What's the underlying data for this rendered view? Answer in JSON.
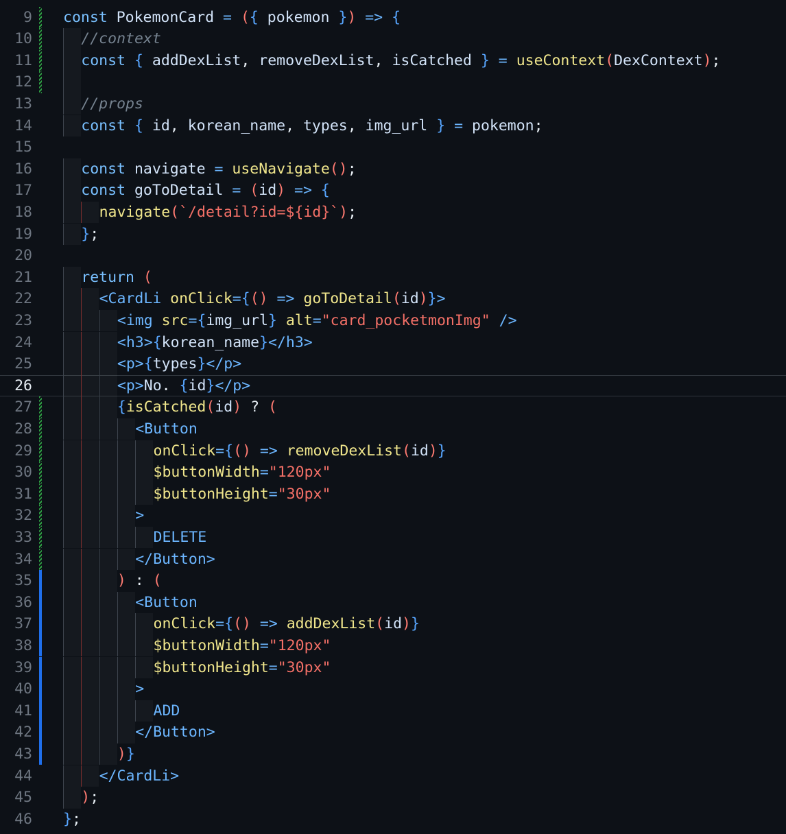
{
  "editor": {
    "colors": {
      "background": "#0d1117",
      "keyword": "#79c0ff",
      "function": "#f0e68c",
      "string": "#f47067",
      "comment": "#768390",
      "modified_marker": "#2ea043",
      "added_marker": "#1f6feb"
    },
    "current_line": 26,
    "lines": [
      {
        "num": "9",
        "indent": 0,
        "marker": "mod",
        "text": "const PokemonCard = ({ pokemon }) => {"
      },
      {
        "num": "10",
        "indent": 1,
        "marker": "mod",
        "text": "//context"
      },
      {
        "num": "11",
        "indent": 1,
        "marker": "mod",
        "text": "const { addDexList, removeDexList, isCatched } = useContext(DexContext);"
      },
      {
        "num": "12",
        "indent": 1,
        "marker": "mod",
        "text": ""
      },
      {
        "num": "13",
        "indent": 1,
        "marker": "",
        "text": "//props"
      },
      {
        "num": "14",
        "indent": 1,
        "marker": "",
        "text": "const { id, korean_name, types, img_url } = pokemon;"
      },
      {
        "num": "15",
        "indent": 0,
        "marker": "",
        "text": ""
      },
      {
        "num": "16",
        "indent": 1,
        "marker": "",
        "text": "const navigate = useNavigate();"
      },
      {
        "num": "17",
        "indent": 1,
        "marker": "",
        "text": "const goToDetail = (id) => {"
      },
      {
        "num": "18",
        "indent": 2,
        "marker": "",
        "text": "navigate(`/detail?id=${id}`);"
      },
      {
        "num": "19",
        "indent": 1,
        "marker": "",
        "text": "};"
      },
      {
        "num": "20",
        "indent": 0,
        "marker": "",
        "text": ""
      },
      {
        "num": "21",
        "indent": 1,
        "marker": "",
        "text": "return ("
      },
      {
        "num": "22",
        "indent": 2,
        "marker": "",
        "text": "<CardLi onClick={() => goToDetail(id)}>"
      },
      {
        "num": "23",
        "indent": 3,
        "marker": "",
        "text": "<img src={img_url} alt=\"card_pocketmonImg\" />"
      },
      {
        "num": "24",
        "indent": 3,
        "marker": "",
        "text": "<h3>{korean_name}</h3>"
      },
      {
        "num": "25",
        "indent": 3,
        "marker": "",
        "text": "<p>{types}</p>"
      },
      {
        "num": "26",
        "indent": 3,
        "marker": "",
        "text": "<p>No. {id}</p>"
      },
      {
        "num": "27",
        "indent": 3,
        "marker": "mod",
        "text": "{isCatched(id) ? ("
      },
      {
        "num": "28",
        "indent": 4,
        "marker": "mod",
        "text": "<Button"
      },
      {
        "num": "29",
        "indent": 5,
        "marker": "mod",
        "text": "onClick={() => removeDexList(id)}"
      },
      {
        "num": "30",
        "indent": 5,
        "marker": "mod",
        "text": "$buttonWidth=\"120px\""
      },
      {
        "num": "31",
        "indent": 5,
        "marker": "mod",
        "text": "$buttonHeight=\"30px\""
      },
      {
        "num": "32",
        "indent": 4,
        "marker": "mod",
        "text": ">"
      },
      {
        "num": "33",
        "indent": 5,
        "marker": "mod",
        "text": "DELETE"
      },
      {
        "num": "34",
        "indent": 4,
        "marker": "mod",
        "text": "</Button>"
      },
      {
        "num": "35",
        "indent": 3,
        "marker": "add",
        "text": ") : ("
      },
      {
        "num": "36",
        "indent": 4,
        "marker": "add",
        "text": "<Button"
      },
      {
        "num": "37",
        "indent": 5,
        "marker": "add",
        "text": "onClick={() => addDexList(id)}"
      },
      {
        "num": "38",
        "indent": 5,
        "marker": "add",
        "text": "$buttonWidth=\"120px\""
      },
      {
        "num": "39",
        "indent": 5,
        "marker": "add",
        "text": "$buttonHeight=\"30px\""
      },
      {
        "num": "40",
        "indent": 4,
        "marker": "add",
        "text": ">"
      },
      {
        "num": "41",
        "indent": 5,
        "marker": "add",
        "text": "ADD"
      },
      {
        "num": "42",
        "indent": 4,
        "marker": "add",
        "text": "</Button>"
      },
      {
        "num": "43",
        "indent": 3,
        "marker": "add",
        "text": ")}"
      },
      {
        "num": "44",
        "indent": 2,
        "marker": "",
        "text": "</CardLi>"
      },
      {
        "num": "45",
        "indent": 1,
        "marker": "",
        "text": ");"
      },
      {
        "num": "46",
        "indent": 0,
        "marker": "",
        "text": "};"
      }
    ]
  }
}
